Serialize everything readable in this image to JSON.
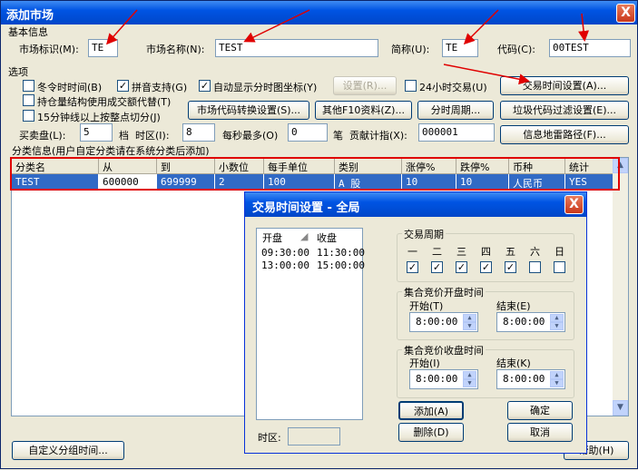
{
  "window": {
    "title": "添加市场",
    "close": "X"
  },
  "basic": {
    "section": "基本信息",
    "market_id_label": "市场标识(M):",
    "market_id_value": "TE",
    "market_name_label": "市场名称(N):",
    "market_name_value": "TEST",
    "abbr_label": "简称(U):",
    "abbr_value": "TE",
    "code_label": "代码(C):",
    "code_value": "00TEST"
  },
  "options": {
    "section": "选项",
    "dst": {
      "label": "冬令时时间(B)",
      "checked": false
    },
    "pinyin": {
      "label": "拼音支持(G)",
      "checked": true
    },
    "auto_coord": {
      "label": "自动显示分时图坐标(Y)",
      "checked": true
    },
    "settings_btn": "设置(R)...",
    "h24": {
      "label": "24小时交易(U)",
      "checked": false
    },
    "trade_time_btn": "交易时间设置(A)...",
    "position": {
      "label": "持仓量结构使用成交额代替(T)",
      "checked": false
    },
    "min15": {
      "label": "15分钟线以上按整点切分(J)",
      "checked": false
    },
    "convert_btn": "市场代码转换设置(S)...",
    "f10_btn": "其他F10资料(Z)...",
    "period_btn": "分时周期...",
    "garbage_btn": "垃圾代码过滤设置(E)...",
    "bid_label": "买卖盘(L):",
    "bid_value": "5",
    "bid_unit": "档",
    "tz_label": "时区(I):",
    "tz_value": "8",
    "max_sec_label": "每秒最多(O)",
    "max_sec_value": "0",
    "max_sec_unit": "笔",
    "contrib_label": "贡献计指(X):",
    "contrib_value": "000001",
    "minefield_btn": "信息地雷路径(F)..."
  },
  "classify": {
    "section": "分类信息(用户自定分类请在系统分类后添加)",
    "headers": [
      "分类名",
      "从",
      "到",
      "小数位",
      "每手单位",
      "类别",
      "涨停%",
      "跌停%",
      "币种",
      "统计"
    ],
    "row": [
      "TEST",
      "600000",
      "699999",
      "2",
      "100",
      "A 股",
      "10",
      "10",
      "人民币",
      "YES"
    ]
  },
  "bottom": {
    "custom_group_btn": "自定义分组时间...",
    "help_btn": "帮助(H)"
  },
  "dialog": {
    "title": "交易时间设置 - 全局",
    "close": "X",
    "col_open": "开盘",
    "col_close": "收盘",
    "sessions": [
      {
        "open": "09:30:00",
        "close": "11:30:00"
      },
      {
        "open": "13:00:00",
        "close": "15:00:00"
      }
    ],
    "tz_label": "时区:",
    "tz_value": "",
    "period_group": "交易周期",
    "days": [
      "一",
      "二",
      "三",
      "四",
      "五",
      "六",
      "日"
    ],
    "days_checked": [
      true,
      true,
      true,
      true,
      true,
      false,
      false
    ],
    "open_auction_group": "集合竞价开盘时间",
    "close_auction_group": "集合竞价收盘时间",
    "start_t_label": "开始(T)",
    "end_e_label": "结束(E)",
    "start_i_label": "开始(I)",
    "end_k_label": "结束(K)",
    "open_start": "8:00:00",
    "open_end": "8:00:00",
    "close_start": "8:00:00",
    "close_end": "8:00:00",
    "add_btn": "添加(A)",
    "ok_btn": "确定",
    "delete_btn": "删除(D)",
    "cancel_btn": "取消"
  },
  "annotation_color": "#e00000"
}
